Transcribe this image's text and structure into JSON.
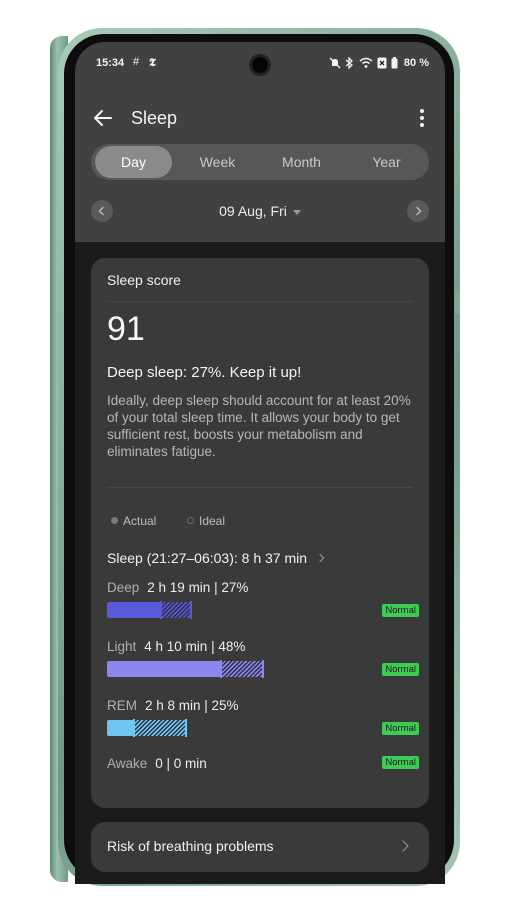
{
  "status_bar": {
    "time": "15:34",
    "battery": "80 %",
    "icons": [
      "hash-icon",
      "news-icon",
      "mute-icon",
      "bluetooth-icon",
      "wifi-icon",
      "sim-off-icon",
      "battery-icon"
    ]
  },
  "app_bar": {
    "title": "Sleep",
    "back_icon": "back-arrow-icon",
    "menu_icon": "more-vert-icon"
  },
  "tabs": [
    {
      "label": "Day",
      "active": true
    },
    {
      "label": "Week",
      "active": false
    },
    {
      "label": "Month",
      "active": false
    },
    {
      "label": "Year",
      "active": false
    }
  ],
  "date_nav": {
    "label": "09 Aug, Fri"
  },
  "sleep_score": {
    "title": "Sleep score",
    "score": "91",
    "headline": "Deep sleep: 27%. Keep it up!",
    "description": "Ideally, deep sleep should account for at least 20% of your total sleep time. It allows your body to get sufficient rest, boosts your metabolism and eliminates fatigue.",
    "legend": {
      "actual": "Actual",
      "ideal": "Ideal"
    },
    "summary": "Sleep (21:27–06:03): 8 h 37 min",
    "stages": [
      {
        "name": "Deep",
        "value": "2 h 19 min | 27%",
        "status": "Normal",
        "color": "#5a5ad8",
        "actual_fraction": 0.22,
        "ideal_fraction": 0.35
      },
      {
        "name": "Light",
        "value": "4 h 10 min | 48%",
        "status": "Normal",
        "color": "#8b86f2",
        "actual_fraction": 0.47,
        "ideal_fraction": 0.65
      },
      {
        "name": "REM",
        "value": "2 h 8 min | 25%",
        "status": "Normal",
        "color": "#6fc6f2",
        "actual_fraction": 0.11,
        "ideal_fraction": 0.33
      },
      {
        "name": "Awake",
        "value": "0 | 0 min",
        "status": "Normal",
        "color": "#e0a050",
        "actual_fraction": 0,
        "ideal_fraction": 0
      }
    ]
  },
  "breathing_card": {
    "title": "Risk of breathing problems"
  },
  "colors": {
    "header_bg": "#414141",
    "card_bg": "#3a3a3a",
    "status_green": "#3ccc56",
    "phone_frame": "#8db5a1"
  }
}
